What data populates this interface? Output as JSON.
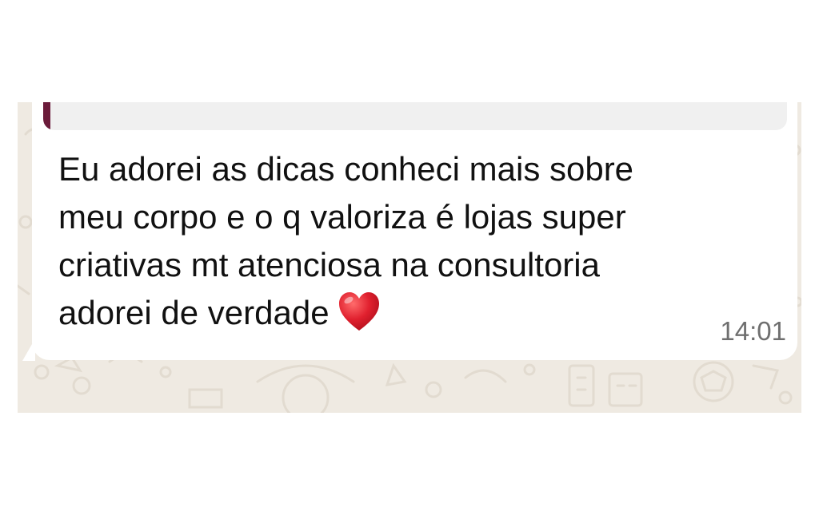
{
  "message": {
    "text": "Eu adorei as dicas conheci mais sobre\nmeu corpo e o q valoriza é lojas super\ncriativas mt atenciosa na consultoria\nadorei de verdade",
    "emoji_icon": "red-heart-icon",
    "time": "14:01"
  },
  "colors": {
    "chat_background": "#efeae2",
    "bubble": "#ffffff",
    "quote_background": "#f0f0f0",
    "quote_accent": "#6b1b3a",
    "text": "#111111",
    "time": "#6f6f6f",
    "heart": "#e0202e"
  }
}
